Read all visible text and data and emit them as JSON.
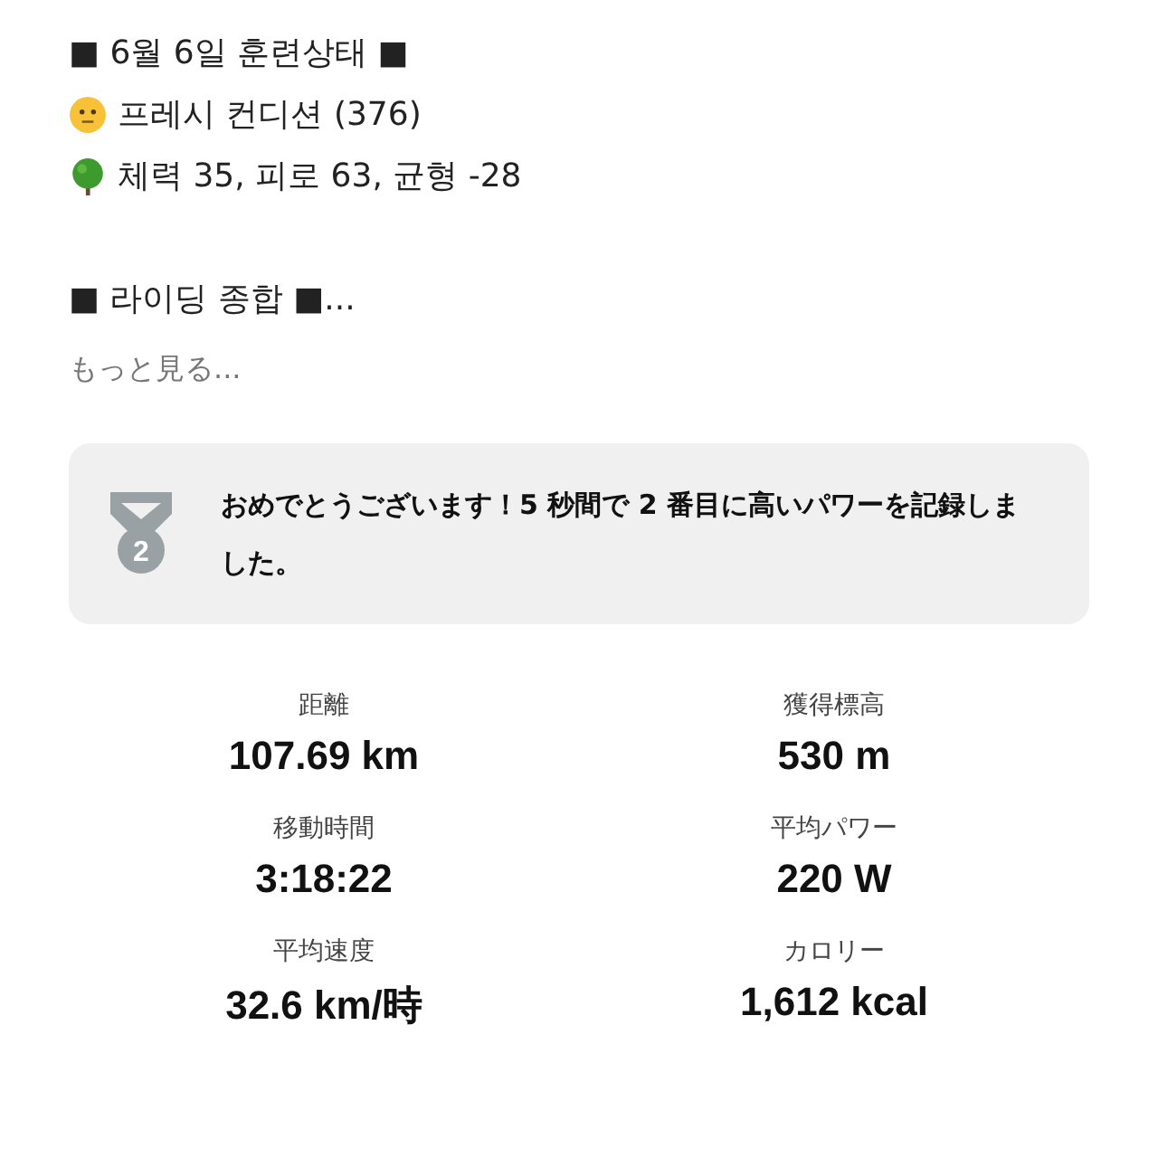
{
  "post": {
    "lines": [
      {
        "kind": "heading",
        "text": "■ 6월 6일 훈련상태 ■"
      },
      {
        "kind": "face",
        "text": "프레시 컨디션 (376)"
      },
      {
        "kind": "tree",
        "text": "체력 35, 피로 63, 균형 -28"
      },
      {
        "kind": "section",
        "text": "■ 라이딩 종합 ■..."
      }
    ],
    "more_link": "もっと見る..."
  },
  "achievement": {
    "rank": "2",
    "message": "おめでとうございます！5 秒間で 2 番目に高いパワーを記録しました。"
  },
  "stats": [
    {
      "label": "距離",
      "value": "107.69 km"
    },
    {
      "label": "獲得標高",
      "value": "530 m"
    },
    {
      "label": "移動時間",
      "value": "3:18:22"
    },
    {
      "label": "平均パワー",
      "value": "220 W"
    },
    {
      "label": "平均速度",
      "value": "32.6 km/時"
    },
    {
      "label": "カロリー",
      "value": "1,612 kcal"
    }
  ]
}
